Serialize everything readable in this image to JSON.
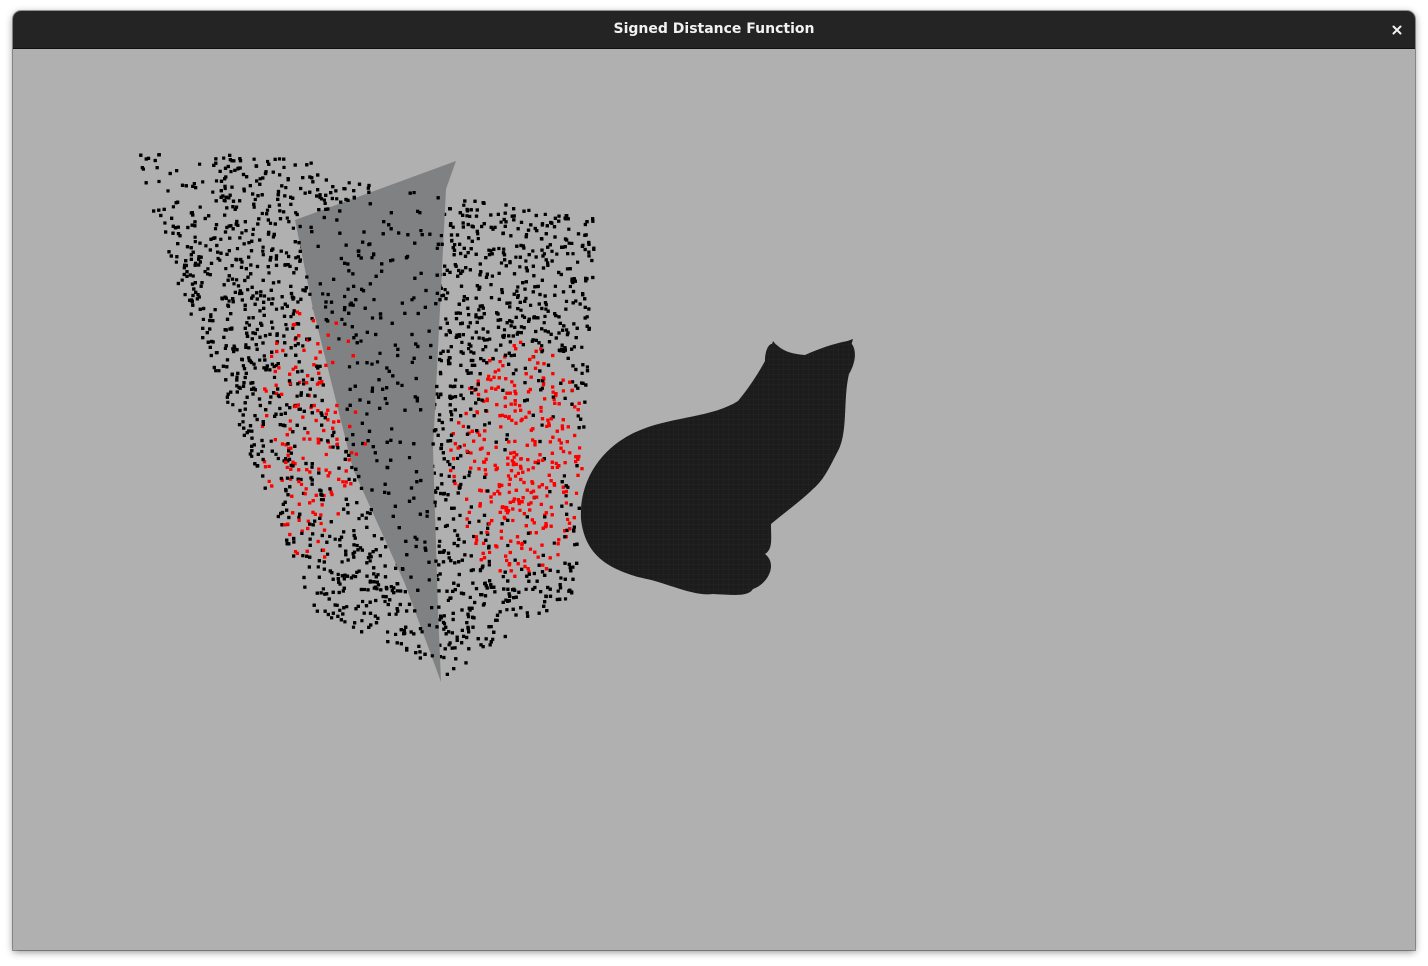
{
  "window": {
    "title": "Signed Distance Function",
    "close_icon": "close-icon"
  },
  "viewport": {
    "background_color": "#b0b0b0",
    "plane_color": "#7f8183",
    "mesh_color": "#1c1c1c",
    "points_outside_color": "#000000",
    "points_inside_color": "#ff0000"
  }
}
